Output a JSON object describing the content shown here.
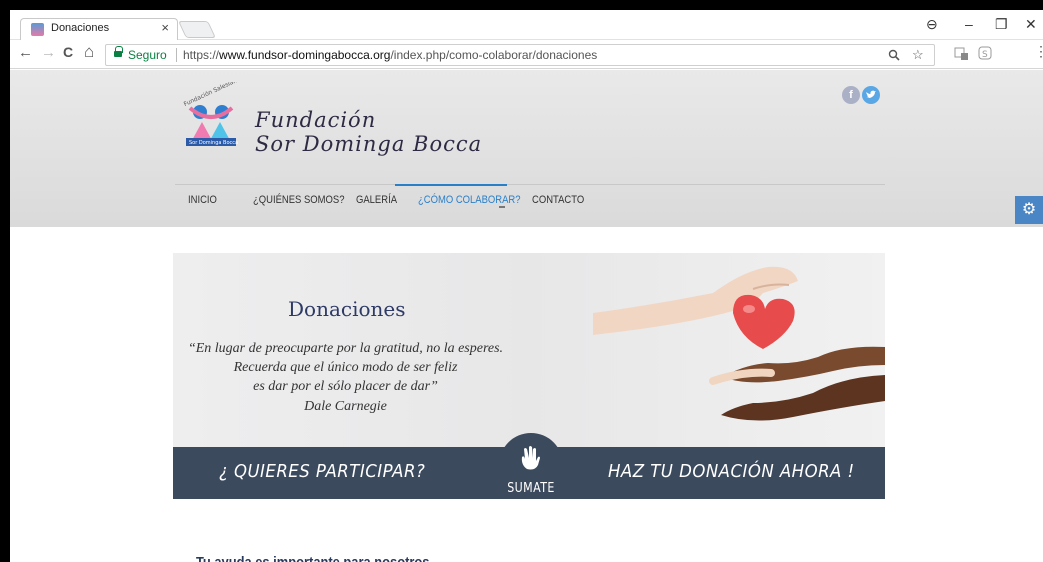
{
  "browser": {
    "tab_title": "Donaciones",
    "tab_close": "×",
    "window_controls": {
      "account": "⊖",
      "minimize": "–",
      "restore": "❐",
      "close": "✕"
    },
    "nav": {
      "back": "←",
      "forward": "→",
      "reload": "C",
      "home": "⌂"
    },
    "secure_label": "Seguro",
    "url_scheme": "https://",
    "url_domain": "www.fundsor-domingabocca.org",
    "url_path": "/index.php/como-colaborar/donaciones",
    "omnibox_icons": {
      "zoom": "🔍",
      "star": "☆"
    }
  },
  "site": {
    "brand_line1": "Fundación",
    "brand_line2": "Sor Dominga Bocca",
    "logo_arc_text": "Fundación Salesiana",
    "logo_label": "Sor Dominga Bocca",
    "social": {
      "facebook": "f",
      "twitter": "t"
    },
    "nav": [
      {
        "label": "INICIO",
        "active": false
      },
      {
        "label": "¿QUIÉNES SOMOS?",
        "active": false
      },
      {
        "label": "GALERÍA",
        "active": false
      },
      {
        "label": "¿CÓMO COLABORAR?",
        "active": true
      },
      {
        "label": "CONTACTO",
        "active": false
      }
    ],
    "gear_icon": "⚙"
  },
  "banner": {
    "title": "Donaciones",
    "quote_lines": [
      "“En lugar de preocuparte por la gratitud, no la esperes.",
      "Recuerda que el único modo de ser feliz",
      "es dar por el sólo placer de dar”",
      "Dale Carnegie"
    ],
    "cta_left": "¿ QUIERES PARTICIPAR?",
    "cta_right": "HAZ TU DONACIÓN AHORA !",
    "sumate_label": "SUMATE",
    "colors": {
      "bar": "#3c4a5e",
      "heart": "#e84b4b",
      "title": "#2e3a66"
    }
  },
  "content": {
    "subheading": "Tu ayuda es importante para nosotros"
  }
}
